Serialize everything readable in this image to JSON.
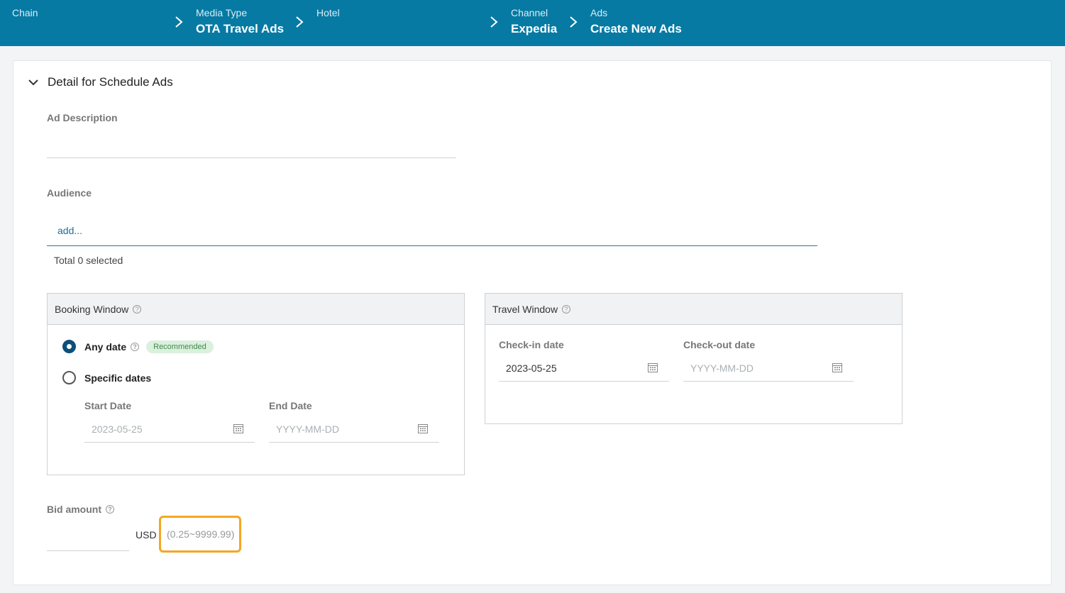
{
  "breadcrumb": {
    "chain": {
      "label": "Chain",
      "value": ""
    },
    "media_type": {
      "label": "Media Type",
      "value": "OTA Travel Ads"
    },
    "hotel": {
      "label": "Hotel",
      "value": ""
    },
    "channel": {
      "label": "Channel",
      "value": "Expedia"
    },
    "ads": {
      "label": "Ads",
      "value": "Create New Ads"
    }
  },
  "section": {
    "title": "Detail for Schedule Ads"
  },
  "ad_description": {
    "label": "Ad Description",
    "value": ""
  },
  "audience": {
    "label": "Audience",
    "add_text": "add...",
    "total_selected": "Total 0 selected"
  },
  "booking_window": {
    "title": "Booking Window",
    "help_icon": "question-circle-icon",
    "options": [
      {
        "label": "Any date",
        "checked": true,
        "badge": "Recommended"
      },
      {
        "label": "Specific dates",
        "checked": false
      }
    ],
    "start_date": {
      "label": "Start Date",
      "value": "2023-05-25"
    },
    "end_date": {
      "label": "End Date",
      "placeholder": "YYYY-MM-DD"
    }
  },
  "travel_window": {
    "title": "Travel Window",
    "checkin": {
      "label": "Check-in date",
      "value": "2023-05-25"
    },
    "checkout": {
      "label": "Check-out date",
      "placeholder": "YYYY-MM-DD"
    }
  },
  "bid": {
    "label": "Bid amount",
    "value": "",
    "currency": "USD",
    "range": "(0.25~9999.99)"
  },
  "colors": {
    "header_bg": "#077aa3",
    "highlight": "#f5a623",
    "radio_checked": "#0c4f79"
  }
}
